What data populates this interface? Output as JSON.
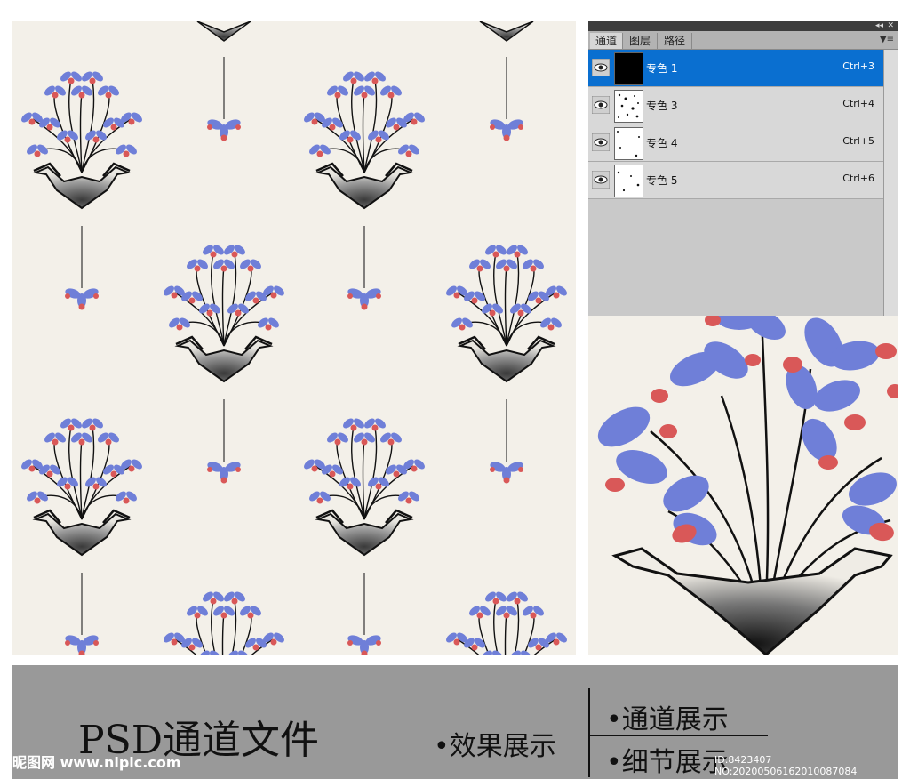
{
  "panel": {
    "tabs": [
      {
        "label": "通道",
        "active": true
      },
      {
        "label": "图层",
        "active": false
      },
      {
        "label": "路径",
        "active": false
      }
    ],
    "collapse_icon": "double-chevron-icon",
    "menu_icon": "panel-menu-icon",
    "channels": [
      {
        "name": "专色 1",
        "shortcut": "Ctrl+3",
        "selected": true
      },
      {
        "name": "专色 3",
        "shortcut": "Ctrl+4",
        "selected": false
      },
      {
        "name": "专色 4",
        "shortcut": "Ctrl+5",
        "selected": false
      },
      {
        "name": "专色 5",
        "shortcut": "Ctrl+6",
        "selected": false
      }
    ]
  },
  "caption": {
    "title": "PSD通道文件",
    "effect": "•效果展示",
    "channels": "•通道展示",
    "details": "•细节展示",
    "watermark_site": "昵图网 www.nipic.com",
    "watermark_id": "ID:8423407 NO:20200506162010087084"
  },
  "colors": {
    "petal_blue": "#6f7fd8",
    "petal_red": "#d95858",
    "background": "#f3f0e9",
    "selected_row": "#0a6fd0"
  }
}
